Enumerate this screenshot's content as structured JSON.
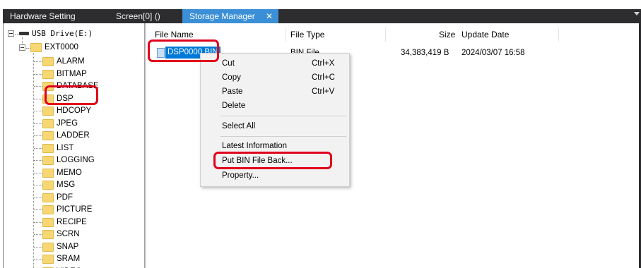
{
  "tabs": [
    {
      "label": "Hardware Setting",
      "active": false
    },
    {
      "label": "Screen[0] ()",
      "active": false
    },
    {
      "label": "Storage Manager",
      "active": true,
      "close": "✕"
    }
  ],
  "tree": {
    "drive_label": "USB Drive(E:)",
    "root_folder": "EXT0000",
    "folders": [
      "ALARM",
      "BITMAP",
      "DATABASE",
      "DSP",
      "HDCOPY",
      "JPEG",
      "LADDER",
      "LIST",
      "LOGGING",
      "MEMO",
      "MSG",
      "PDF",
      "PICTURE",
      "RECIPE",
      "SCRN",
      "SNAP",
      "SRAM",
      "VIDEO"
    ]
  },
  "list": {
    "columns": {
      "name": "File Name",
      "type": "File Type",
      "size": "Size",
      "date": "Update Date"
    },
    "rows": [
      {
        "name": "DSP0000.BIN",
        "type": "BIN File",
        "size": "34,383,419 B",
        "date": "2024/03/07 16:58"
      }
    ]
  },
  "context_menu": {
    "cut": "Cut",
    "cut_sc": "Ctrl+X",
    "copy": "Copy",
    "copy_sc": "Ctrl+C",
    "paste": "Paste",
    "paste_sc": "Ctrl+V",
    "delete": "Delete",
    "select_all": "Select All",
    "latest": "Latest Information",
    "put_back": "Put BIN File Back...",
    "property": "Property..."
  },
  "colors": {
    "highlight": "#e0001b",
    "selection": "#0078d7",
    "active_tab": "#3b8fd6",
    "tab_strip": "#2d2d30"
  }
}
